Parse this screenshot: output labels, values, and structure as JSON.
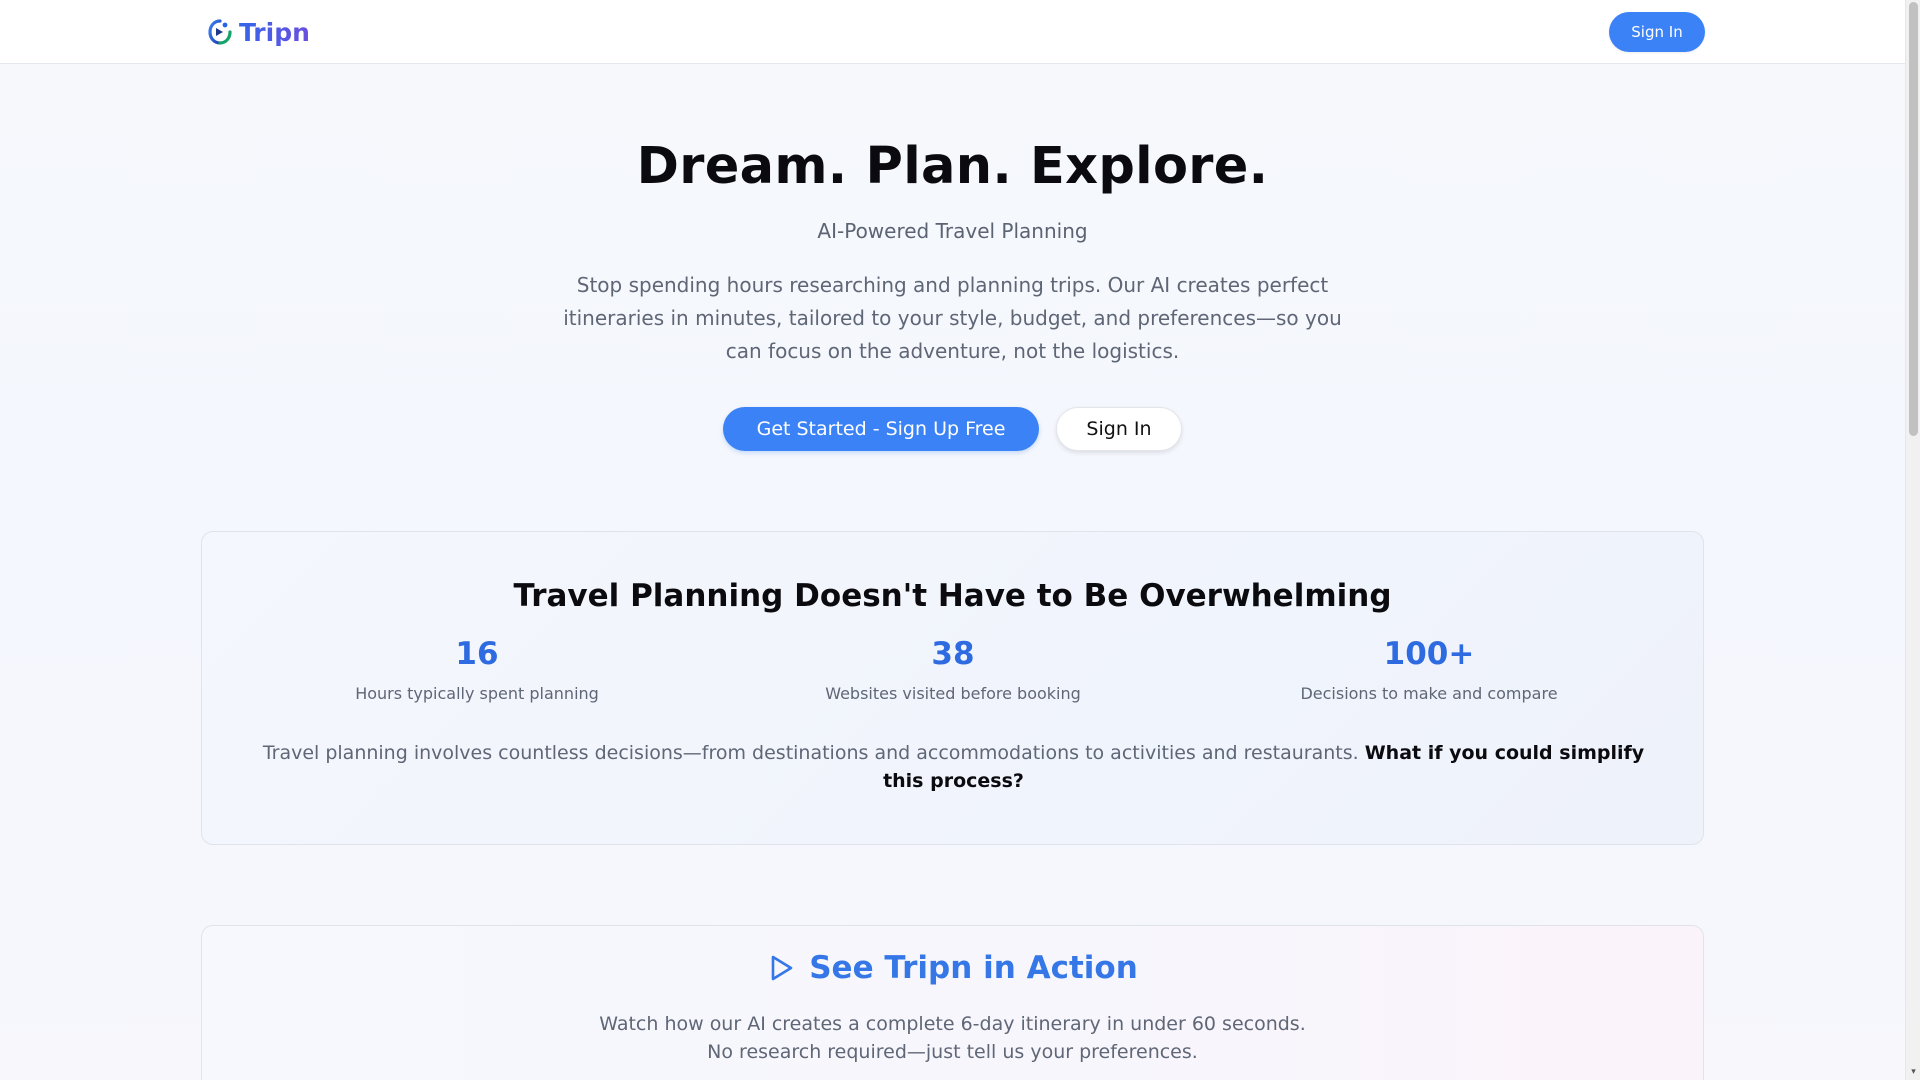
{
  "header": {
    "logo_text": "Tripn",
    "logo_icon": "tripn-logo-icon",
    "signin_label": "Sign In"
  },
  "hero": {
    "title": "Dream. Plan. Explore.",
    "subtitle": "AI-Powered Travel Planning",
    "description": "Stop spending hours researching and planning trips. Our AI creates perfect itineraries in minutes, tailored to your style, budget, and preferences—so you can focus on the adventure, not the logistics.",
    "primary_cta": "Get Started - Sign Up Free",
    "secondary_cta": "Sign In"
  },
  "stats_card": {
    "title": "Travel Planning Doesn't Have to Be Overwhelming",
    "stats": [
      {
        "value": "16",
        "label": "Hours typically spent planning"
      },
      {
        "value": "38",
        "label": "Websites visited before booking"
      },
      {
        "value": "100+",
        "label": "Decisions to make and compare"
      }
    ],
    "note": "Travel planning involves countless decisions—from destinations and accommodations to activities and restaurants.",
    "note_bold": "What if you could simplify this process?"
  },
  "action_card": {
    "icon": "play-icon",
    "title": "See Tripn in Action",
    "line1": "Watch how our AI creates a complete 6-day itinerary in under 60 seconds.",
    "line2": "No research required—just tell us your preferences."
  },
  "colors": {
    "accent": "#3b82f6",
    "stat_value": "#2f6be0",
    "action_title": "#3577e6"
  }
}
